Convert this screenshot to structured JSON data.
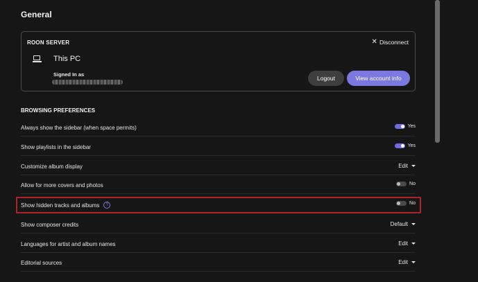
{
  "page": {
    "title": "General"
  },
  "server": {
    "heading": "ROON SERVER",
    "disconnect_label": "Disconnect",
    "name": "This PC",
    "signed_in_label": "Signed In as",
    "logout_label": "Logout",
    "account_label": "View account info"
  },
  "browsing": {
    "heading": "BROWSING PREFERENCES",
    "rows": [
      {
        "label": "Always show the sidebar (when space permits)",
        "control": "toggle",
        "state": "on",
        "value": "Yes"
      },
      {
        "label": "Show playlists in the sidebar",
        "control": "toggle",
        "state": "on",
        "value": "Yes"
      },
      {
        "label": "Customize album display",
        "control": "dropdown",
        "value": "Edit"
      },
      {
        "label": "Allow for more covers and photos",
        "control": "toggle",
        "state": "off",
        "value": "No"
      },
      {
        "label": "Show hidden tracks and albums",
        "control": "toggle",
        "state": "off",
        "value": "No",
        "help": "?"
      },
      {
        "label": "Show composer credits",
        "control": "dropdown",
        "value": "Default"
      },
      {
        "label": "Languages for artist and album names",
        "control": "dropdown",
        "value": "Edit"
      },
      {
        "label": "Editorial sources",
        "control": "dropdown",
        "value": "Edit"
      }
    ]
  },
  "colors": {
    "accent": "#7b78e0",
    "highlight": "#b22028",
    "background": "#161616"
  },
  "icons": {
    "server": "monitor-icon",
    "disconnect": "close-icon",
    "help": "help-icon",
    "dropdown": "caret-down-icon"
  }
}
